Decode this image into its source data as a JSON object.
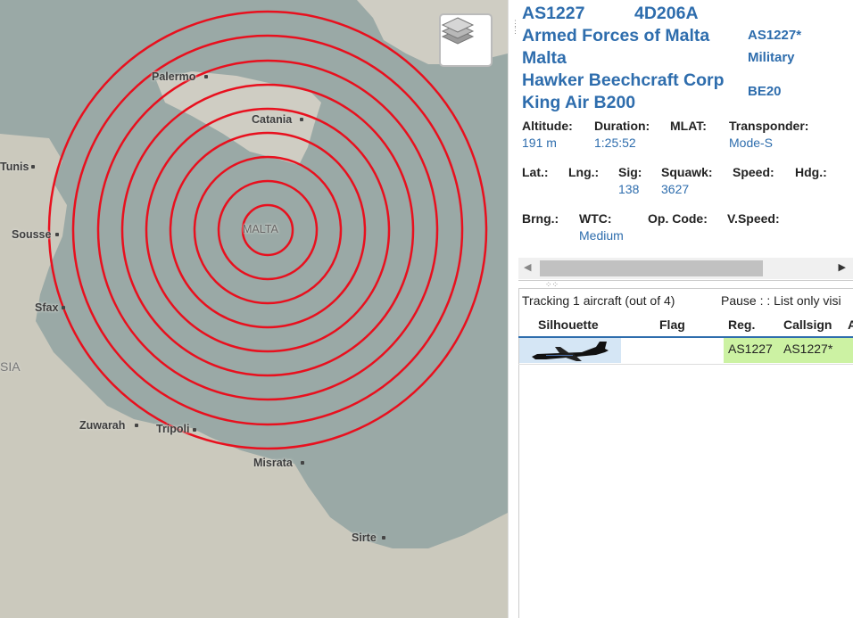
{
  "map": {
    "cities": [
      {
        "name": "Palermo"
      },
      {
        "name": "Catania"
      },
      {
        "name": "Tunis"
      },
      {
        "name": "Sousse"
      },
      {
        "name": "MALTA"
      },
      {
        "name": "Sfax"
      },
      {
        "name": "SIA"
      },
      {
        "name": "Zuwarah"
      },
      {
        "name": "Tripoli"
      },
      {
        "name": "Misrata"
      },
      {
        "name": "Sirte"
      }
    ],
    "range_ring_color": "#e8101e",
    "layers_button_icon": "layers-icon"
  },
  "aircraft": {
    "registration": "AS1227",
    "icao_hex": "4D206A",
    "operator": "Armed Forces of Malta",
    "callsign": "AS1227*",
    "country": "Malta",
    "category": "Military",
    "manufacturer": "Hawker Beechcraft Corp",
    "model": "King Air B200",
    "type_code": "BE20"
  },
  "fields": {
    "altitude": {
      "label": "Altitude:",
      "value": "191 m"
    },
    "duration": {
      "label": "Duration:",
      "value": "1:25:52"
    },
    "mlat": {
      "label": "MLAT:",
      "value": ""
    },
    "transponder": {
      "label": "Transponder:",
      "value": "Mode-S"
    },
    "lat": {
      "label": "Lat.:",
      "value": ""
    },
    "lng": {
      "label": "Lng.:",
      "value": ""
    },
    "sig": {
      "label": "Sig:",
      "value": "138"
    },
    "squawk": {
      "label": "Squawk:",
      "value": "3627"
    },
    "speed": {
      "label": "Speed:",
      "value": ""
    },
    "hdg": {
      "label": "Hdg.:",
      "value": ""
    },
    "brng": {
      "label": "Brng.:",
      "value": ""
    },
    "wtc": {
      "label": "WTC:",
      "value": "Medium"
    },
    "opcode": {
      "label": "Op. Code:",
      "value": ""
    },
    "vspeed": {
      "label": "V.Speed:",
      "value": ""
    }
  },
  "list": {
    "tracking_text": "Tracking 1 aircraft (out of 4)",
    "pause_text": "Pause : : List only visi",
    "columns": [
      "Silhouette",
      "Flag",
      "Reg.",
      "Callsign",
      "A"
    ],
    "rows": [
      {
        "reg": "AS1227",
        "callsign": "AS1227*",
        "flag": ""
      }
    ]
  }
}
